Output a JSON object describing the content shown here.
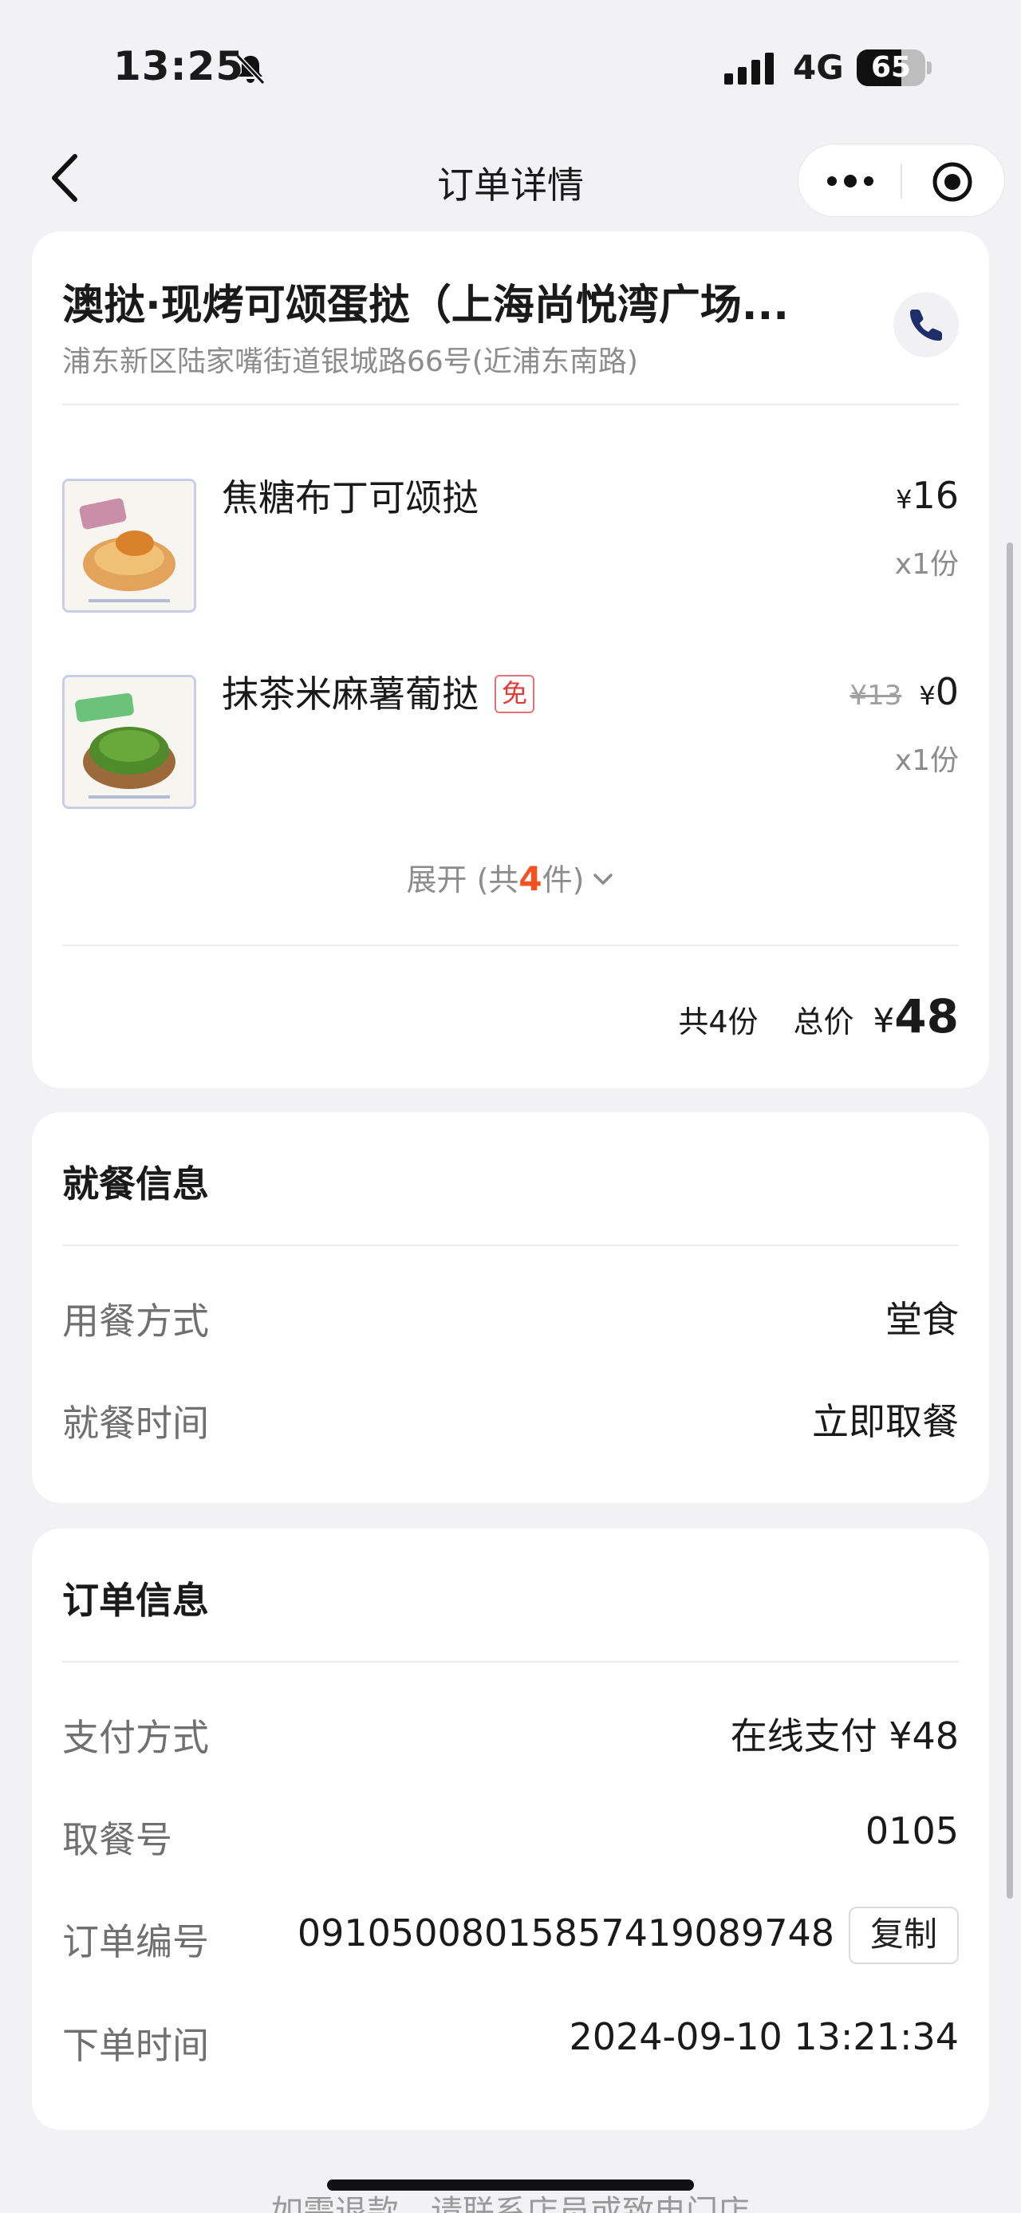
{
  "status_bar": {
    "time": "13:25",
    "network": "4G",
    "battery": "65",
    "battery_level_percent": 65
  },
  "nav": {
    "title": "订单详情"
  },
  "store": {
    "name": "澳挞·现烤可颂蛋挞（上海尚悦湾广场...",
    "address": "浦东新区陆家嘴街道银城路66号(近浦东南路)"
  },
  "items": [
    {
      "name": "焦糖布丁可颂挞",
      "price": "16",
      "currency": "¥",
      "qty": "x1份"
    },
    {
      "name": "抹茶米麻薯葡挞",
      "badge": "免",
      "original_price": "¥13",
      "price": "0",
      "currency": "¥",
      "qty": "x1份"
    }
  ],
  "expand": {
    "prefix": "展开 (共",
    "count": "4",
    "suffix": "件)"
  },
  "summary": {
    "count_label": "共4份",
    "total_label": "总价",
    "currency": "¥",
    "total": "48"
  },
  "dining_info": {
    "title": "就餐信息",
    "rows": [
      {
        "label": "用餐方式",
        "value": "堂食"
      },
      {
        "label": "就餐时间",
        "value": "立即取餐"
      }
    ]
  },
  "order_info": {
    "title": "订单信息",
    "payment": {
      "label": "支付方式",
      "value": "在线支付 ¥48"
    },
    "pickup": {
      "label": "取餐号",
      "value": "0105"
    },
    "order_number": {
      "label": "订单编号",
      "value": "09105008015857419089748",
      "copy_label": "复制"
    },
    "order_time": {
      "label": "下单时间",
      "value": "2024-09-10 13:21:34"
    }
  },
  "footer": {
    "note": "如需退款，请联系店员或致电门店"
  },
  "colors": {
    "accent_orange": "#f4511e",
    "badge_red": "#e53935",
    "muted_text": "#8c8c8c"
  }
}
